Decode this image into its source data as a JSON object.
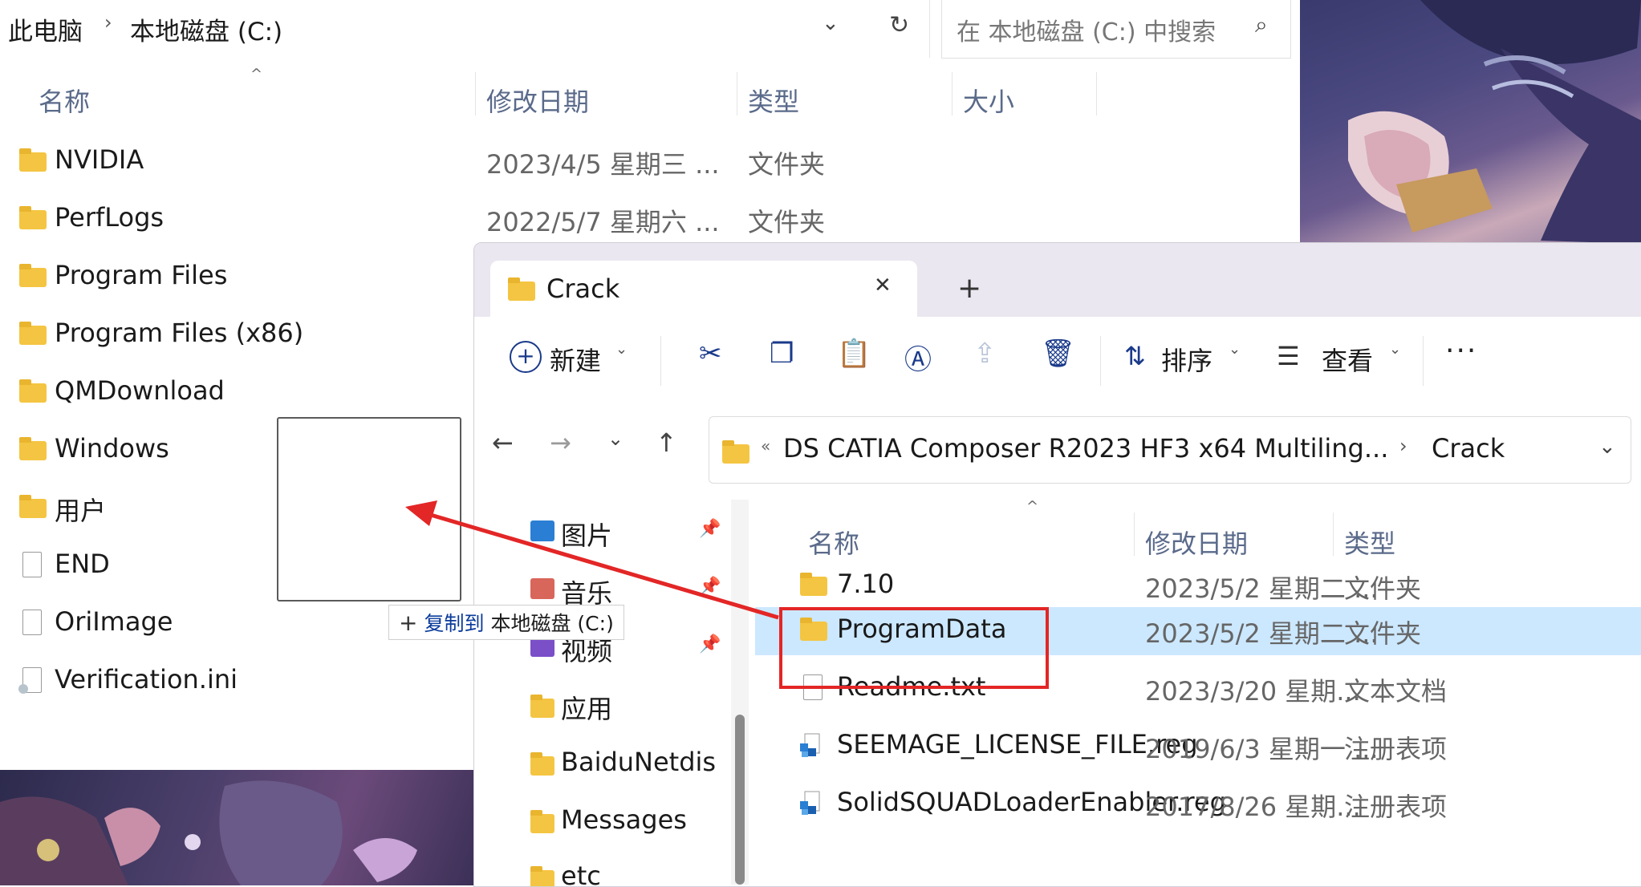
{
  "back_window": {
    "breadcrumb": [
      "此电脑",
      "本地磁盘 (C:)"
    ],
    "breadcrumb_sep": "›",
    "search_placeholder": "在 本地磁盘 (C:) 中搜索",
    "columns": {
      "name": "名称",
      "date": "修改日期",
      "type": "类型",
      "size": "大小"
    },
    "rows": [
      {
        "name": "NVIDIA",
        "date": "2023/4/5 星期三 ...",
        "type": "文件夹",
        "kind": "folder"
      },
      {
        "name": "PerfLogs",
        "date": "2022/5/7 星期六 ...",
        "type": "文件夹",
        "kind": "folder"
      },
      {
        "name": "Program Files",
        "date": "",
        "type": "",
        "kind": "folder"
      },
      {
        "name": "Program Files (x86)",
        "date": "",
        "type": "",
        "kind": "folder"
      },
      {
        "name": "QMDownload",
        "date": "",
        "type": "",
        "kind": "folder"
      },
      {
        "name": "Windows",
        "date": "",
        "type": "",
        "kind": "folder"
      },
      {
        "name": "用户",
        "date": "",
        "type": "",
        "kind": "folder"
      },
      {
        "name": "END",
        "date": "",
        "type": "",
        "kind": "file"
      },
      {
        "name": "OriImage",
        "date": "",
        "type": "",
        "kind": "file"
      },
      {
        "name": "Verification.ini",
        "date": "",
        "type": "",
        "kind": "ini"
      }
    ]
  },
  "drag": {
    "plus": "+",
    "action": "复制到",
    "destination": "本地磁盘 (C:)"
  },
  "front_window": {
    "tab_title": "Crack",
    "new_tab": "+",
    "close": "✕",
    "toolbar": {
      "new_label": "新建",
      "sort_label": "排序",
      "view_label": "查看",
      "more": "···"
    },
    "address": {
      "overflow": "«",
      "path": [
        "DS CATIA Composer R2023 HF3 x64 Multiling...",
        "Crack"
      ],
      "sep": "›"
    },
    "nav_items": [
      {
        "label": "图片",
        "pinned": true,
        "icon": "pictures-icon"
      },
      {
        "label": "音乐",
        "pinned": true,
        "icon": "music-icon"
      },
      {
        "label": "视频",
        "pinned": true,
        "icon": "videos-icon"
      },
      {
        "label": "应用",
        "pinned": false,
        "icon": "folder-icon"
      },
      {
        "label": "BaiduNetdis",
        "pinned": false,
        "icon": "folder-icon"
      },
      {
        "label": "Messages",
        "pinned": false,
        "icon": "folder-icon"
      },
      {
        "label": "etc",
        "pinned": false,
        "icon": "folder-icon"
      }
    ],
    "columns": {
      "name": "名称",
      "date": "修改日期",
      "type": "类型"
    },
    "rows": [
      {
        "name": "7.10",
        "date": "2023/5/2 星期二 ...",
        "type": "文件夹",
        "kind": "folder"
      },
      {
        "name": "ProgramData",
        "date": "2023/5/2 星期二 ...",
        "type": "文件夹",
        "kind": "folder"
      },
      {
        "name": "Readme.txt",
        "date": "2023/3/20 星期...",
        "type": "文本文档",
        "kind": "text"
      },
      {
        "name": "SEEMAGE_LICENSE_FILE.reg",
        "date": "2019/6/3 星期一 ...",
        "type": "注册表项",
        "kind": "reg"
      },
      {
        "name": "SolidSQUADLoaderEnabler.reg",
        "date": "2017/8/26 星期...",
        "type": "注册表项",
        "kind": "reg"
      }
    ]
  },
  "colors": {
    "accent": "#1a3a8a",
    "selection": "#cce8ff",
    "highlight_box": "#e32626",
    "folder": "#f4c542"
  }
}
